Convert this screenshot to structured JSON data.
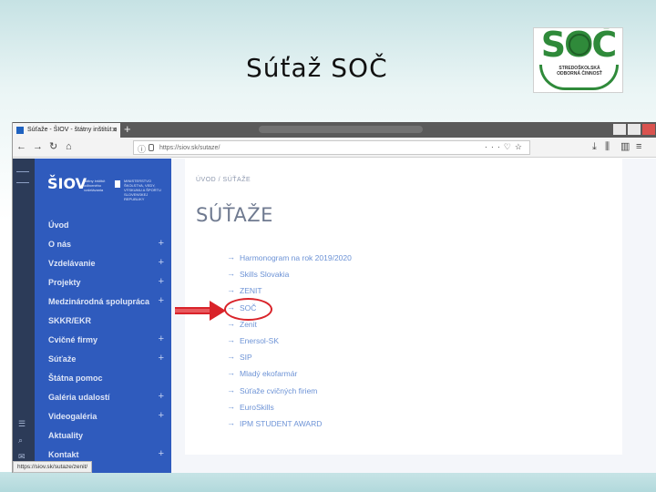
{
  "slide": {
    "title": "Súťaž SOČ"
  },
  "logo": {
    "letters": "SOČ",
    "text": "STREDOŠKOLSKÁ ODBORNÁ ČINNOSŤ",
    "color": "#2f8a3a"
  },
  "browser": {
    "tab_title": "Súťaže - ŠIOV - štátny inštitút o",
    "url": "https://siov.sk/sutaze/",
    "status_url": "https://siov.sk/sutaze/zenit/"
  },
  "site": {
    "brand": "ŠIOV",
    "brand_sub": "štátny inštitút odborného vzdelávania",
    "brand_sub2": "MINISTERSTVO ŠKOLSTVA, VEDY, VÝSKUMU A ŠPORTU SLOVENSKEJ REPUBLIKY",
    "accent": "#2f5bbd",
    "menu": [
      {
        "label": "Úvod",
        "plus": ""
      },
      {
        "label": "O nás",
        "plus": "+"
      },
      {
        "label": "Vzdelávanie",
        "plus": "+"
      },
      {
        "label": "Projekty",
        "plus": "+"
      },
      {
        "label": "Medzinárodná spolupráca",
        "plus": "+"
      },
      {
        "label": "SKKR/EKR",
        "plus": ""
      },
      {
        "label": "Cvičné firmy",
        "plus": "+"
      },
      {
        "label": "Súťaže",
        "plus": "+"
      },
      {
        "label": "Štátna pomoc",
        "plus": ""
      },
      {
        "label": "Galéria udalostí",
        "plus": "+"
      },
      {
        "label": "Videogaléria",
        "plus": "+"
      },
      {
        "label": "Aktuality",
        "plus": ""
      },
      {
        "label": "Kontakt",
        "plus": "+"
      }
    ],
    "breadcrumb": "ÚVOD   /   SÚŤAŽE",
    "heading": "SÚŤAŽE",
    "links": [
      "Harmonogram na rok 2019/2020",
      "Skills Slovakia",
      "ZENIT",
      "SOČ",
      "Zenit",
      "Enersol-SK",
      "SIP",
      "Mladý ekofarmár",
      "Súťaže cvičných firiem",
      "EuroSkills",
      "IPM STUDENT AWARD"
    ]
  },
  "annotation": {
    "color": "#d9232a"
  }
}
